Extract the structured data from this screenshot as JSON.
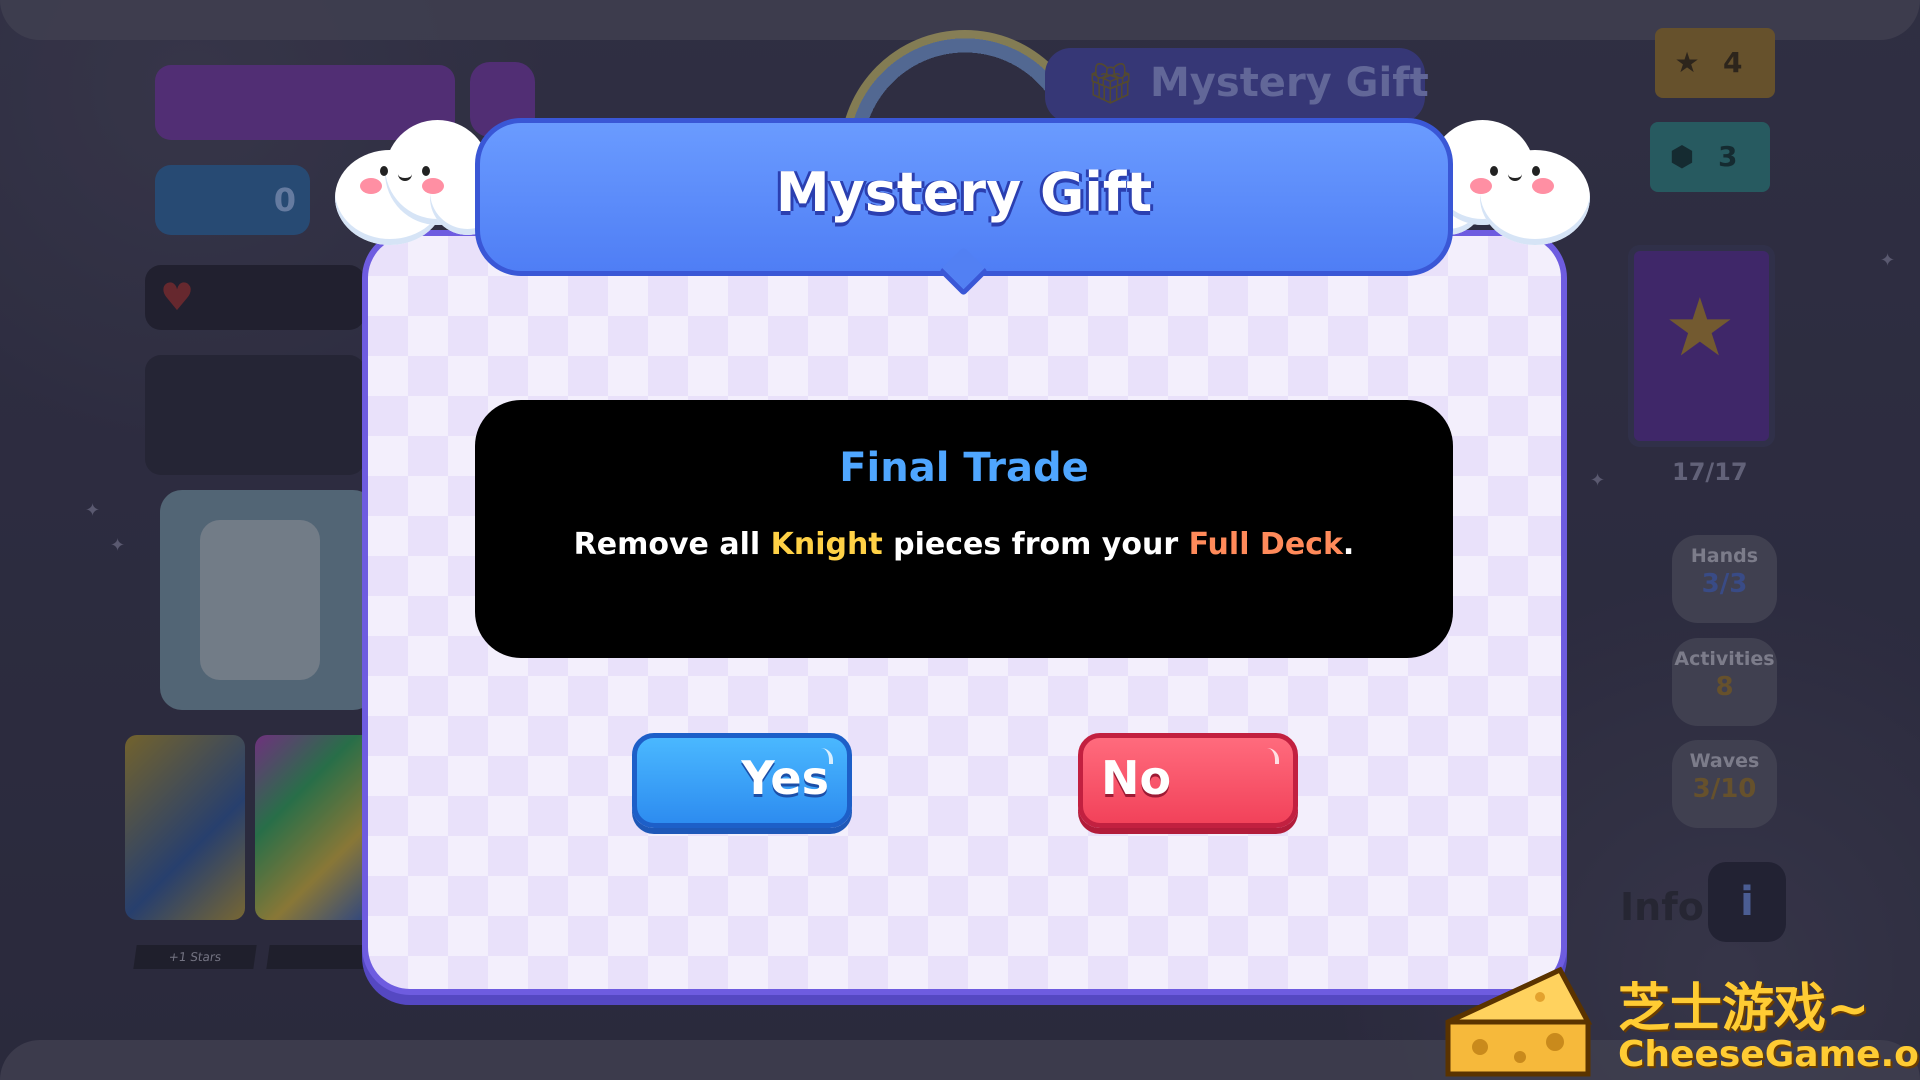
{
  "dialog": {
    "title": "Mystery Gift",
    "gift_name": "Final Trade",
    "description": {
      "prefix": "Remove all ",
      "highlight_1": "Knight",
      "middle": " pieces from your ",
      "highlight_2": "Full Deck",
      "suffix": "."
    },
    "yes_label": "Yes",
    "no_label": "No"
  },
  "background": {
    "title": "Mystery Gift",
    "left_hud": {
      "blue_counter": "0",
      "booster_label_1": "+1 Stars"
    },
    "resources": {
      "stars": "4",
      "gems": "3"
    },
    "deck_count": "17/17",
    "stats": [
      {
        "label": "Hands",
        "value": "3/3"
      },
      {
        "label": "Activities",
        "value": "8"
      },
      {
        "label": "Waves",
        "value": "3/10"
      }
    ],
    "info_label": "Info",
    "info_button": "i"
  },
  "watermark": {
    "chinese": "芝士游戏~",
    "english": "CheeseGame.org"
  },
  "colors": {
    "title_blue": "#5280f3",
    "yes_blue": "#2d8cf0",
    "no_red": "#f2425a",
    "highlight_yellow": "#ffd146",
    "highlight_orange": "#ff8a5a",
    "gift_name_blue": "#4fa6ff"
  },
  "icons": {
    "cloud_left": "cloud-face-icon",
    "cloud_right": "cloud-face-icon",
    "stars_resource": "star-icon",
    "gems_resource": "gem-icon",
    "heart": "heart-icon",
    "info": "info-icon",
    "gift": "gift-icon"
  }
}
